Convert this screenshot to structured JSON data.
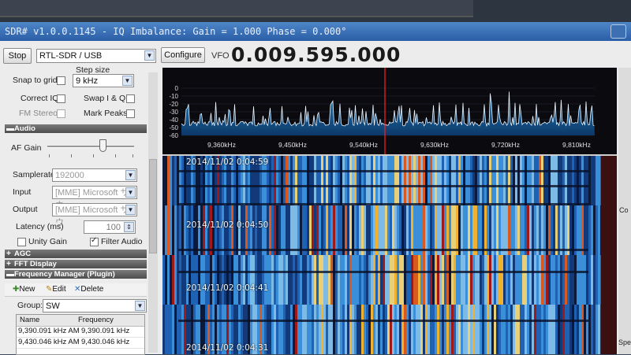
{
  "window": {
    "title": "SDR# v1.0.0.1145 - IQ Imbalance: Gain = 1.000 Phase = 0.000°"
  },
  "toolbar": {
    "stop_label": "Stop",
    "device_value": "RTL-SDR / USB",
    "configure_label": "Configure",
    "vfo_label": "VFO",
    "vfo_value": "0.009.595.000"
  },
  "radio": {
    "step_size_label": "Step size",
    "snap_label": "Snap to grid",
    "snap_checked": false,
    "step_value": "9 kHz",
    "correct_iq_label": "Correct IQ",
    "swap_iq_label": "Swap I & Q",
    "fm_stereo_label": "FM Stereo",
    "mark_peaks_label": "Mark Peaks"
  },
  "audio": {
    "section_label": "Audio",
    "af_gain_label": "AF Gain",
    "af_gain_level": 0.65,
    "samplerate_label": "Samplerate",
    "samplerate_value": "192000",
    "input_label": "Input",
    "input_value": "[MME] Microsoft サウ",
    "output_label": "Output",
    "output_value": "[MME] Microsoft サウ",
    "latency_label": "Latency (ms)",
    "latency_value": "100",
    "unity_gain_label": "Unity Gain",
    "filter_audio_label": "Filter Audio",
    "filter_audio_checked": true
  },
  "sections": {
    "agc": "AGC",
    "fft": "FFT Display",
    "freq_manager": "Frequency Manager (Plugin)"
  },
  "freq_manager": {
    "new_label": "New",
    "edit_label": "Edit",
    "delete_label": "Delete",
    "group_label": "Group:",
    "group_value": "SW",
    "columns": [
      "Name",
      "Frequency"
    ],
    "rows": [
      {
        "name": "9,390.091 kHz AM",
        "frequency": "9,390.091 kHz"
      },
      {
        "name": "9,430.046 kHz AM",
        "frequency": "9,430.046 kHz"
      }
    ]
  },
  "spectrum": {
    "db_ticks": [
      "0",
      "-10",
      "-20",
      "-30",
      "-40",
      "-50",
      "-60"
    ],
    "freq_ticks": [
      "9,360kHz",
      "9,450kHz",
      "9,540kHz",
      "9,630kHz",
      "9,720kHz",
      "9,810kHz"
    ],
    "trace_color": "#e8f4ff",
    "fill_color": "#1c7ec4",
    "cursor_color": "#ff2020"
  },
  "waterfall": {
    "timestamps": [
      "2014/11/02 0:04:59",
      "2014/11/02 0:04:50",
      "2014/11/02 0:04:41",
      "2014/11/02 0:04:31"
    ]
  },
  "right_panel": {
    "con_label": "Co",
    "speed_label": "Spee"
  }
}
